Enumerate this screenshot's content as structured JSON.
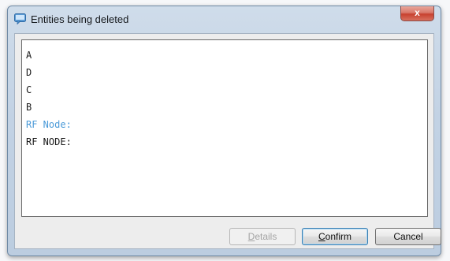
{
  "dialog": {
    "title": "Entities being deleted",
    "close_label": "x"
  },
  "list": {
    "items": [
      {
        "text": "A",
        "style": "normal"
      },
      {
        "text": "D",
        "style": "normal"
      },
      {
        "text": "C",
        "style": "normal"
      },
      {
        "text": "B",
        "style": "normal"
      },
      {
        "text": "RF Node:",
        "style": "blue"
      },
      {
        "text": "RF NODE:",
        "style": "normal"
      }
    ],
    "highlight_color": "#4a9ad8"
  },
  "buttons": {
    "details": {
      "first": "D",
      "rest": "etails",
      "enabled": false
    },
    "confirm": {
      "first": "C",
      "rest": "onfirm",
      "enabled": true
    },
    "cancel": {
      "label": "Cancel",
      "enabled": true
    }
  },
  "colors": {
    "titlebar": "#c2d2e4",
    "close_button": "#c8412f"
  }
}
